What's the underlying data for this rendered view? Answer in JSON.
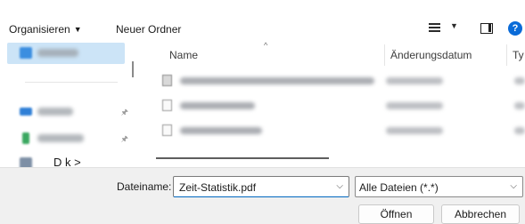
{
  "toolbar": {
    "organize_label": "Organisieren",
    "organize_caret": "▼",
    "new_folder_label": "Neuer Ordner",
    "view_caret": "▼",
    "help_label": "?"
  },
  "nav": {
    "pin_glyph": "🖈",
    "partial_label": "D k                >"
  },
  "columns": {
    "name": "Name",
    "sort_glyph": "^",
    "date": "Änderungsdatum",
    "type": "Ty"
  },
  "footer": {
    "filename_label": "Dateiname:",
    "filename_value": "Zeit-Statistik.pdf",
    "filetype_value": "Alle Dateien (*.*)",
    "chevron": "⌵",
    "open_label": "Öffnen",
    "cancel_label": "Abbrechen"
  },
  "colors": {
    "accent": "#0067c0",
    "selection": "#cce4f7",
    "help_badge": "#0a6bd8"
  }
}
